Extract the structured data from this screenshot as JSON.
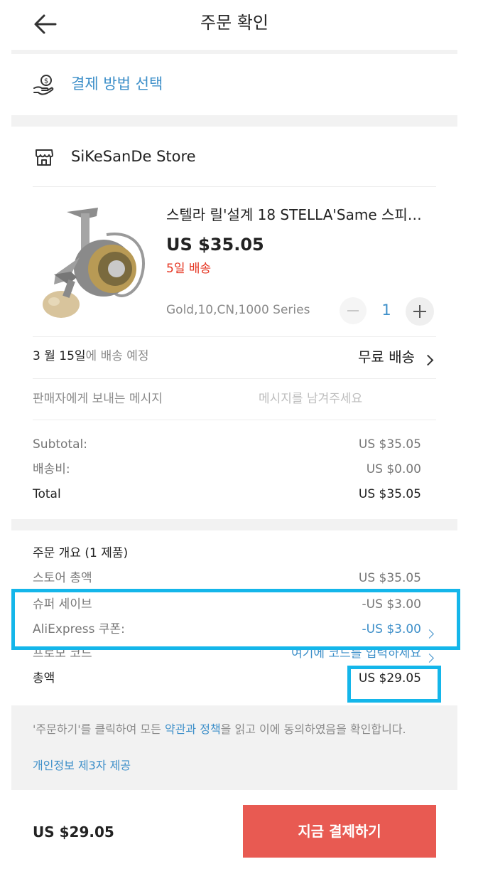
{
  "header": {
    "title": "주문 확인"
  },
  "payment": {
    "label": "결제 방법 선택"
  },
  "store": {
    "name": "SiKeSanDe Store"
  },
  "product": {
    "title": "스텔라 릴'설계 18 STELLA'Same 스피…",
    "price": "US $35.05",
    "delivery_days": "5일 배송",
    "variant": "Gold,10,CN,1000 Series",
    "quantity": "1"
  },
  "shipping": {
    "date": "3 월 15일",
    "date_suffix": "에 배송 예정",
    "method": "무료 배송"
  },
  "message": {
    "label": "판매자에게 보내는 메시지",
    "placeholder": "메시지를 남겨주세요"
  },
  "costs": {
    "subtotal_label": "Subtotal:",
    "subtotal_value": "US $35.05",
    "shipping_label": "배송비:",
    "shipping_value": "US $0.00",
    "total_label": "Total",
    "total_value": "US $35.05"
  },
  "summary": {
    "title": "주문 개요 (1 제품)",
    "store_total_label": "스토어 총액",
    "store_total_value": "US $35.05",
    "super_save_label": "슈퍼 세이브",
    "super_save_value": "-US $3.00",
    "coupon_label": "AliExpress 쿠폰:",
    "coupon_value": "-US $3.00",
    "promo_label": "프로모 코드",
    "promo_value": "여기에 코드를 입력하세요",
    "total_label": "총액",
    "total_value": "US $29.05"
  },
  "terms": {
    "prefix": "'주문하기'를 클릭하여 모든 ",
    "link": "약관과 정책",
    "suffix": "을 읽고 이에 동의하였음을 확인합니다.",
    "privacy_link": "개인정보 제3자 제공"
  },
  "footer": {
    "total": "US $29.05",
    "pay_button": "지금 결제하기"
  },
  "colors": {
    "accent_blue": "#3d8fc9",
    "pay_red": "#e85a52",
    "highlight_cyan": "#14b6ea",
    "delivery_red": "#e5331f"
  }
}
